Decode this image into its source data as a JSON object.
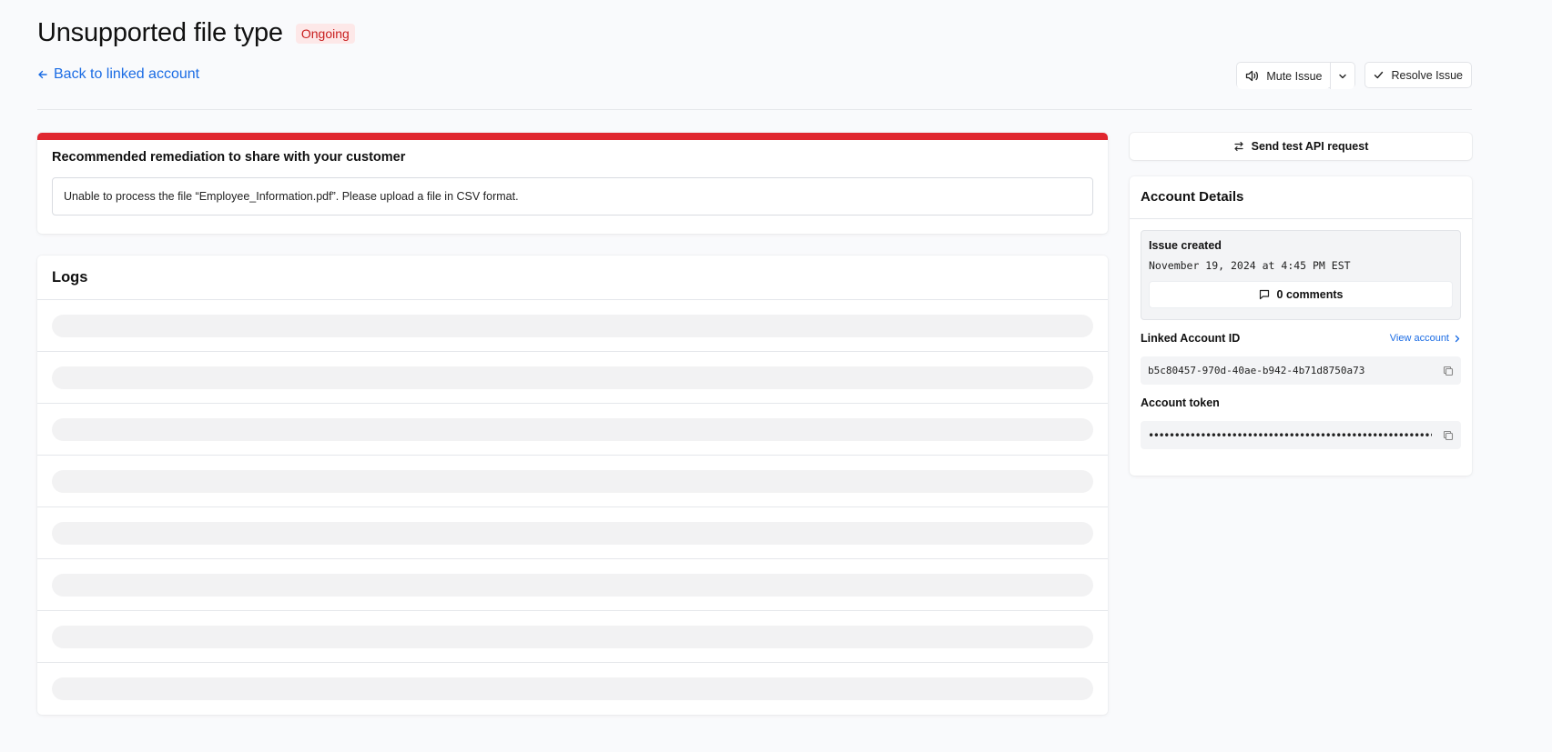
{
  "header": {
    "title": "Unsupported file type",
    "status": "Ongoing",
    "back_link": "Back to linked account"
  },
  "actions": {
    "mute_label": "Mute Issue",
    "resolve_label": "Resolve Issue"
  },
  "remediation": {
    "title": "Recommended remediation to share with your customer",
    "message": "Unable to process the file “Employee_Information.pdf”. Please upload a file in CSV format."
  },
  "logs": {
    "title": "Logs",
    "loading_rows": 8
  },
  "sidebar": {
    "send_test_label": "Send test API request",
    "details_title": "Account Details",
    "issue_created_label": "Issue created",
    "issue_created_date": "November 19, 2024 at 4:45 PM EST",
    "comments_label": "0 comments",
    "linked_account_label": "Linked Account ID",
    "view_account_label": "View account",
    "linked_account_id": "b5c80457-970d-40ae-b942-4b71d8750a73",
    "token_label": "Account token",
    "token_value": "••••••••••••••••••••••••••••••••••••••••••••••••••••••••••••"
  },
  "colors": {
    "accent_blue": "#1b6ce4",
    "error_red": "#e0262f",
    "badge_bg": "#fde8e8",
    "badge_text": "#c81e1e",
    "page_bg": "#f9fafc"
  }
}
